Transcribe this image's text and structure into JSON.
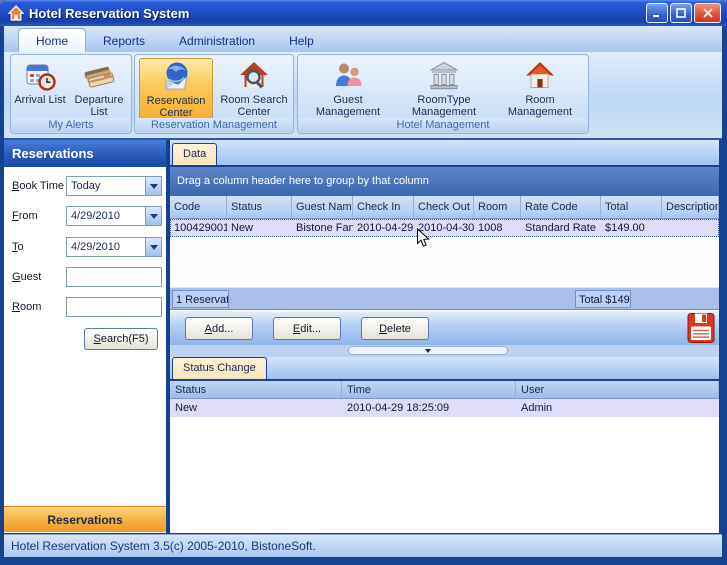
{
  "window": {
    "title": "Hotel Reservation System",
    "status_text": "Hotel Reservation System 3.5(c) 2005-2010, BistoneSoft."
  },
  "tabs": [
    {
      "label": "Home",
      "active": true
    },
    {
      "label": "Reports",
      "active": false
    },
    {
      "label": "Administration",
      "active": false
    },
    {
      "label": "Help",
      "active": false
    }
  ],
  "ribbon": {
    "groups": [
      {
        "label": "My Alerts",
        "buttons": [
          {
            "label": "Arrival List",
            "icon": "calendar-clock-icon",
            "selected": false
          },
          {
            "label": "Departure List",
            "icon": "credit-cards-icon",
            "selected": false
          }
        ]
      },
      {
        "label": "Reservation Management",
        "buttons": [
          {
            "label": "Reservation Center",
            "icon": "globe-mail-icon",
            "selected": true
          },
          {
            "label": "Room Search Center",
            "icon": "house-search-icon",
            "selected": false
          }
        ]
      },
      {
        "label": "Hotel Management",
        "buttons": [
          {
            "label": "Guest Management",
            "icon": "guests-icon",
            "selected": false
          },
          {
            "label": "RoomType Management",
            "icon": "bank-icon",
            "selected": false
          },
          {
            "label": "Room Management",
            "icon": "house-icon",
            "selected": false
          }
        ]
      }
    ]
  },
  "sidebar": {
    "header": "Reservations",
    "fields": [
      {
        "label": "Book Time",
        "value": "Today",
        "type": "dropdown"
      },
      {
        "label": "From",
        "value": "4/29/2010",
        "type": "date-dropdown"
      },
      {
        "label": "To",
        "value": "4/29/2010",
        "type": "date-dropdown"
      },
      {
        "label": "Guest",
        "value": "",
        "type": "text"
      },
      {
        "label": "Room",
        "value": "",
        "type": "text"
      }
    ],
    "search_button": "Search(F5)",
    "bottom_button": "Reservations"
  },
  "main": {
    "tab": "Data",
    "group_hint": "Drag a column header here to group by that column",
    "grid": {
      "columns": [
        "Code",
        "Status",
        "Guest Name",
        "Check In",
        "Check Out",
        "Room",
        "Rate Code",
        "Total",
        "Description"
      ],
      "rows": [
        [
          "100429001",
          "New",
          "Bistone Fan",
          "2010-04-29",
          "2010-04-30",
          "1008",
          "Standard Rate",
          "$149.00",
          ""
        ]
      ]
    },
    "summary_count": "1 Reservat",
    "summary_total": "Total $149",
    "buttons": [
      "Add...",
      "Edit...",
      "Delete"
    ]
  },
  "status_change": {
    "tab": "Status Change",
    "columns": [
      "Status",
      "Time",
      "User"
    ],
    "rows": [
      [
        "New",
        "2010-04-29 18:25:09",
        "Admin"
      ]
    ]
  },
  "colors": {
    "titlebar_blue": "#1f4ecc",
    "selected_ribbon_orange": "#fbc552",
    "selected_row_lavender": "#dedcf8",
    "tab_cream": "#f8e6ba",
    "sidebar_bottom_orange": "#f6ae40"
  }
}
